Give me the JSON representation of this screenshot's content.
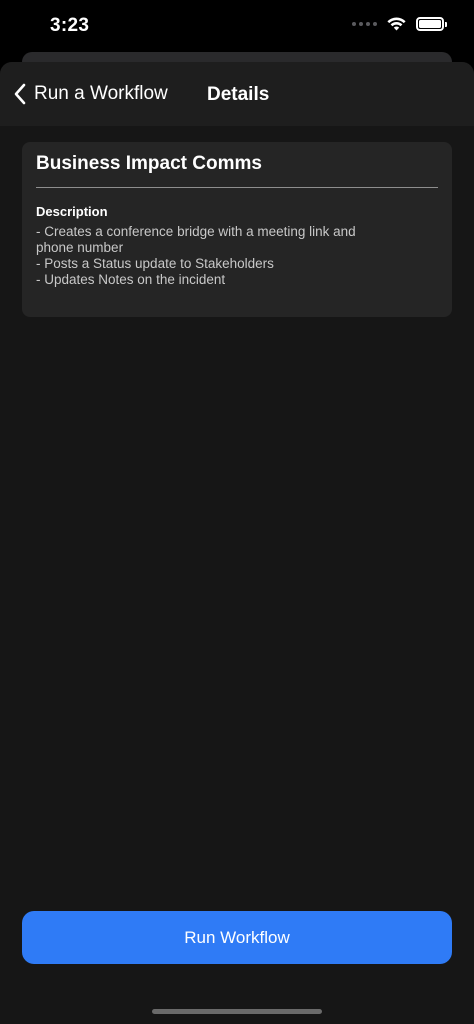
{
  "status_bar": {
    "time": "3:23"
  },
  "nav": {
    "back_label": "Run a Workflow",
    "title": "Details"
  },
  "workflow": {
    "name": "Business Impact Comms",
    "description_label": "Description",
    "description": "- Creates a conference bridge with a meeting link and phone number\n- Posts a Status update to Stakeholders\n- Updates Notes on the incident"
  },
  "actions": {
    "run_label": "Run Workflow"
  },
  "colors": {
    "accent": "#2f7bf6",
    "background": "#161616",
    "card": "#252525"
  }
}
